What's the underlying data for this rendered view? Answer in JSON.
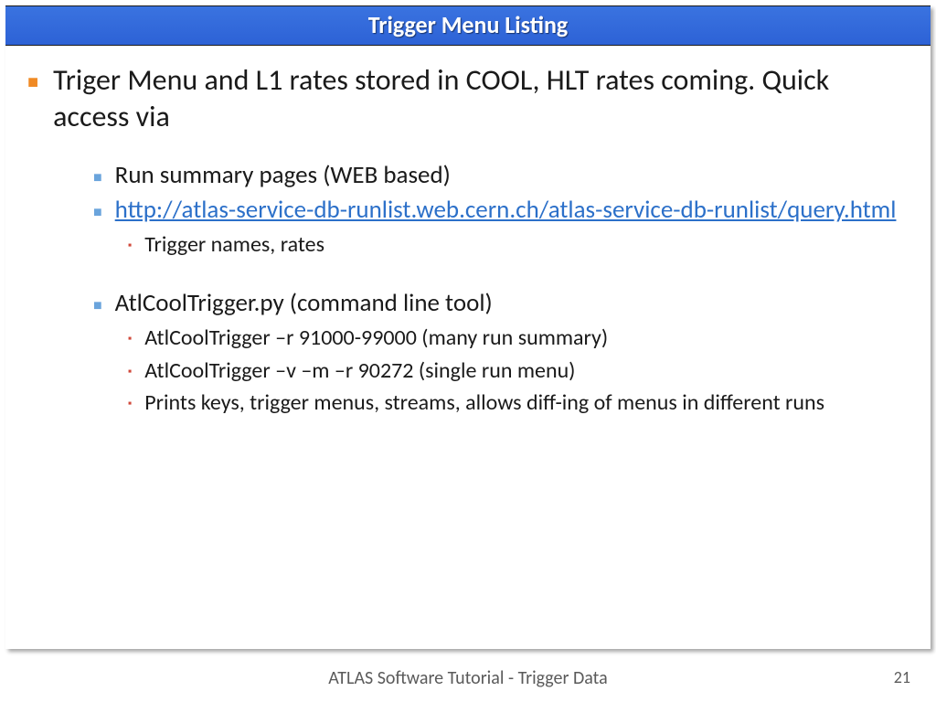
{
  "title": "Trigger Menu Listing",
  "main_bullet": "Triger Menu and L1 rates stored in COOL, HLT rates coming. Quick access via",
  "sub": {
    "run_summary": "Run summary pages (WEB based)",
    "link": "http://atlas-service-db-runlist.web.cern.ch/atlas-service-db-runlist/query.html",
    "link_sub": "Trigger names, rates",
    "tool": "AtlCoolTrigger.py (command line tool)",
    "tool_sub1": "AtlCoolTrigger –r 91000-99000 (many run summary)",
    "tool_sub2": "AtlCoolTrigger –v –m –r 90272 (single run menu)",
    "tool_sub3": "Prints keys, trigger menus, streams, allows diff-ing of menus in different runs"
  },
  "footer": "ATLAS Software Tutorial - Trigger Data",
  "page": "21"
}
